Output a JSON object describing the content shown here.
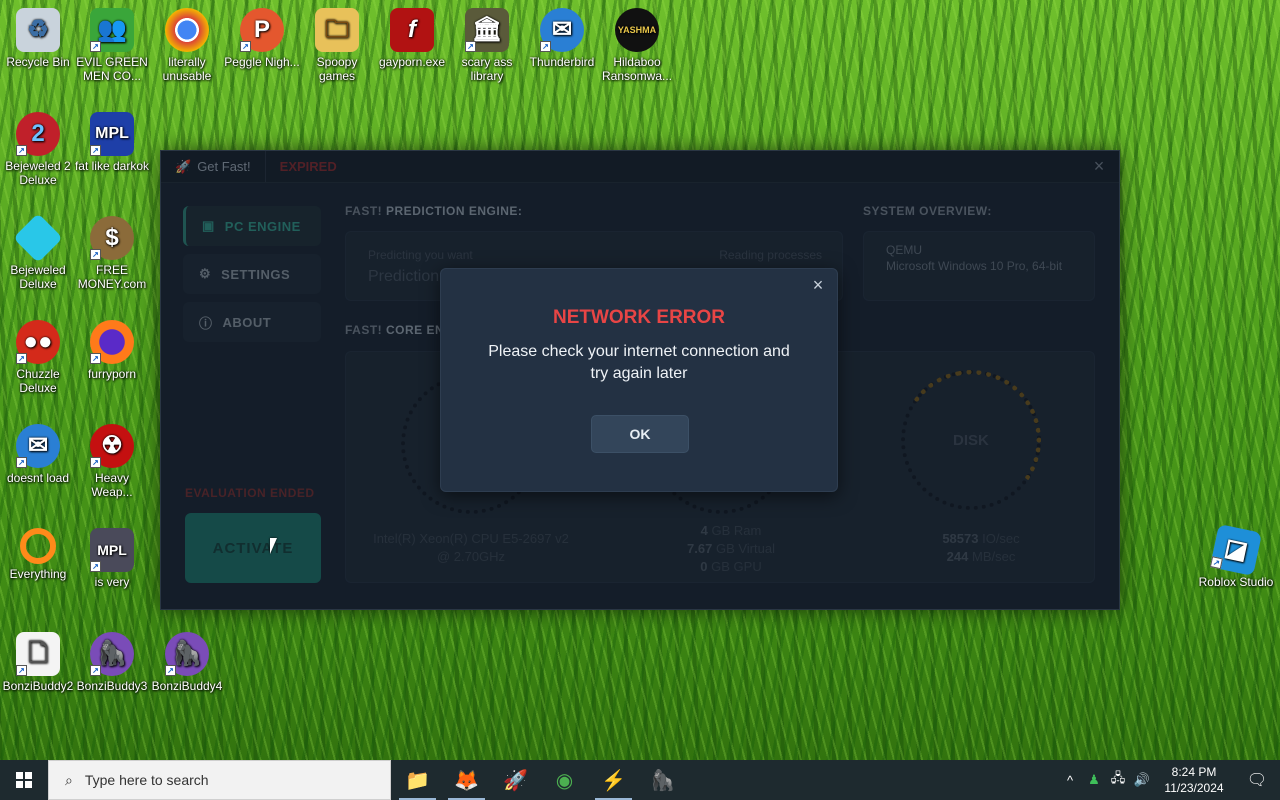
{
  "desktop": {
    "icons": [
      {
        "label": "Recycle Bin",
        "name": "recycle-bin-icon"
      },
      {
        "label": "EVIL GREEN MEN CO...",
        "name": "evil-green-men-icon"
      },
      {
        "label": "literally unusable",
        "name": "chrome-icon"
      },
      {
        "label": "Peggle Nigh...",
        "name": "peggle-icon"
      },
      {
        "label": "Spoopy games",
        "name": "folder-icon"
      },
      {
        "label": "gayporn.exe",
        "name": "flash-icon"
      },
      {
        "label": "scary ass library",
        "name": "library-icon"
      },
      {
        "label": "Thunderbird",
        "name": "thunderbird-icon"
      },
      {
        "label": "Hildaboo Ransomwa...",
        "name": "ransomware-icon"
      },
      {
        "label": "Bejeweled 2 Deluxe",
        "name": "bejeweled2-icon"
      },
      {
        "label": "fat like darkok",
        "name": "mpl-icon"
      },
      {
        "label": "Bejeweled Deluxe",
        "name": "bejeweled-icon"
      },
      {
        "label": "FREE MONEY.com",
        "name": "money-bag-icon"
      },
      {
        "label": "Chuzzle Deluxe",
        "name": "chuzzle-icon"
      },
      {
        "label": "furryporn",
        "name": "firefox-icon"
      },
      {
        "label": "doesnt load",
        "name": "thunderbird-icon"
      },
      {
        "label": "Heavy Weap...",
        "name": "heavy-weapon-icon"
      },
      {
        "label": "Everything",
        "name": "everything-search-icon"
      },
      {
        "label": "is very",
        "name": "mpl-shield-icon"
      },
      {
        "label": "BonziBuddy2",
        "name": "bonzibuddy-folder-icon"
      },
      {
        "label": "BonziBuddy3",
        "name": "bonzibuddy-icon"
      },
      {
        "label": "BonziBuddy4",
        "name": "bonzibuddy-icon"
      },
      {
        "label": "Roblox Studio",
        "name": "roblox-studio-icon"
      }
    ]
  },
  "app": {
    "tab_title": "Get Fast!",
    "tab_status": "EXPIRED",
    "close_glyph": "×",
    "sidebar": [
      {
        "label": "PC ENGINE",
        "icon": "chip-icon",
        "glyph": "▣"
      },
      {
        "label": "SETTINGS",
        "icon": "gear-icon",
        "glyph": "⚙"
      },
      {
        "label": "ABOUT",
        "icon": "info-icon",
        "glyph": "ⓘ"
      }
    ],
    "eval_ended": "EVALUATION ENDED",
    "activate": "ACTIVATE",
    "prediction": {
      "label_prefix": "FAST!",
      "label": "PREDICTION ENGINE:",
      "hint_left": "Predicting you want",
      "hint_right": "Reading processes",
      "value": "Prediction"
    },
    "system": {
      "label": "SYSTEM OVERVIEW:",
      "machine": "QEMU",
      "os": "Microsoft Windows 10 Pro, 64-bit"
    },
    "core": {
      "label_prefix": "FAST!",
      "label": "CORE EN"
    },
    "cpu_text": "Intel(R) Xeon(R) CPU E5-2697 v2 @ 2.70GHz",
    "mem": {
      "ram_val": "4",
      "ram_unit": "GB Ram",
      "virt_val": "7.67",
      "virt_unit": "GB Virtual",
      "gpu_val": "0",
      "gpu_unit": "GB GPU"
    },
    "disk": {
      "label": "DISK",
      "io_val": "58573",
      "io_unit": "IO/sec",
      "mb_val": "244",
      "mb_unit": "MB/sec"
    }
  },
  "modal": {
    "title": "NETWORK ERROR",
    "message": "Please check your internet connection and try again later",
    "ok": "OK",
    "close_glyph": "×"
  },
  "taskbar": {
    "search_placeholder": "Type here to search",
    "apps": [
      {
        "name": "file-explorer-icon",
        "glyph": "📁"
      },
      {
        "name": "firefox-icon",
        "glyph": "🦊"
      },
      {
        "name": "rocket-icon",
        "glyph": "🚀"
      },
      {
        "name": "chrome-icon",
        "glyph": "◉"
      },
      {
        "name": "get-fast-icon",
        "glyph": "⚡"
      },
      {
        "name": "bonzibuddy-icon",
        "glyph": "🦍"
      }
    ],
    "time": "8:24 PM",
    "date": "11/23/2024"
  }
}
